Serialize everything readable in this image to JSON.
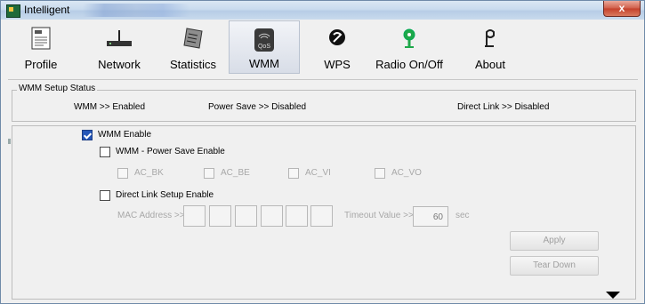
{
  "window": {
    "title": "Intelligent",
    "close_glyph": "x"
  },
  "toolbar": {
    "items": [
      {
        "label": "Profile",
        "icon": "profile-icon"
      },
      {
        "label": "Network",
        "icon": "network-icon"
      },
      {
        "label": "Statistics",
        "icon": "statistics-icon"
      },
      {
        "label": "WMM",
        "icon": "wmm-qos-icon",
        "active": true,
        "icon_text": "QoS"
      },
      {
        "label": "WPS",
        "icon": "wps-icon"
      },
      {
        "label": "Radio On/Off",
        "icon": "radio-icon"
      },
      {
        "label": "About",
        "icon": "about-icon"
      }
    ]
  },
  "status": {
    "legend": "WMM Setup Status",
    "wmm": "WMM >> Enabled",
    "power_save": "Power Save >> Disabled",
    "direct_link": "Direct Link >> Disabled"
  },
  "settings": {
    "wmm_enable": {
      "label": "WMM Enable",
      "checked": true
    },
    "power_save_enable": {
      "label": "WMM - Power Save Enable",
      "checked": false
    },
    "ac_options": [
      "AC_BK",
      "AC_BE",
      "AC_VI",
      "AC_VO"
    ],
    "direct_link_enable": {
      "label": "Direct Link Setup Enable",
      "checked": false
    },
    "mac_address_label": "MAC Address >>",
    "mac_address_values": [
      "",
      "",
      "",
      "",
      "",
      ""
    ],
    "timeout_label": "Timeout Value >>",
    "timeout_value": "60",
    "timeout_unit": "sec"
  },
  "buttons": {
    "apply": "Apply",
    "tear_down": "Tear Down"
  },
  "colors": {
    "checked": "#2456b8",
    "disabled_text": "#a8a8a8",
    "close_button": "#c4402b"
  }
}
